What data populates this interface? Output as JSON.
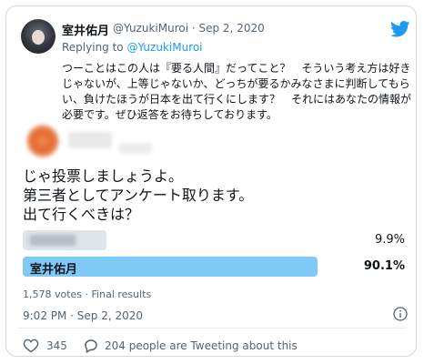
{
  "author": {
    "name": "室井佑月",
    "handle_date": "@YuzukiMuroi · Sep 2, 2020"
  },
  "reply": {
    "prefix": "Replying to ",
    "mention": "@YuzukiMuroi"
  },
  "quoted_text": "つーことはこの人は『要る人間』だってこと？　そういう考え方は好きじゃないが、上等じゃないか、どっちが要るかみなさまに判断してもらい、負けたほうが日本を出て行くにします？　それにはあなたの情報が必要です。ぜひ返答をお待ちしております。",
  "body_text": "じゃ投票しましょうよ。\n第三者としてアンケート取ります。\n出て行くべきは？",
  "poll": {
    "options": [
      {
        "label": "",
        "percent_label": "9.9%",
        "fraction": 0.099
      },
      {
        "label": "室井佑月",
        "percent_label": "90.1%",
        "fraction": 0.901
      }
    ],
    "meta": "1,578 votes · Final results"
  },
  "timestamp": "9:02 PM · Sep 2, 2020",
  "engagement": {
    "likes": "345",
    "tweeting": "204 people are Tweeting about this"
  },
  "colors": {
    "twitter_blue": "#1d9bf0",
    "winner_bar": "#7ccaf5",
    "loser_bar": "#dfe4e8"
  },
  "icons": [
    "twitter-bird-icon",
    "info-icon",
    "heart-icon",
    "reply-icon"
  ]
}
